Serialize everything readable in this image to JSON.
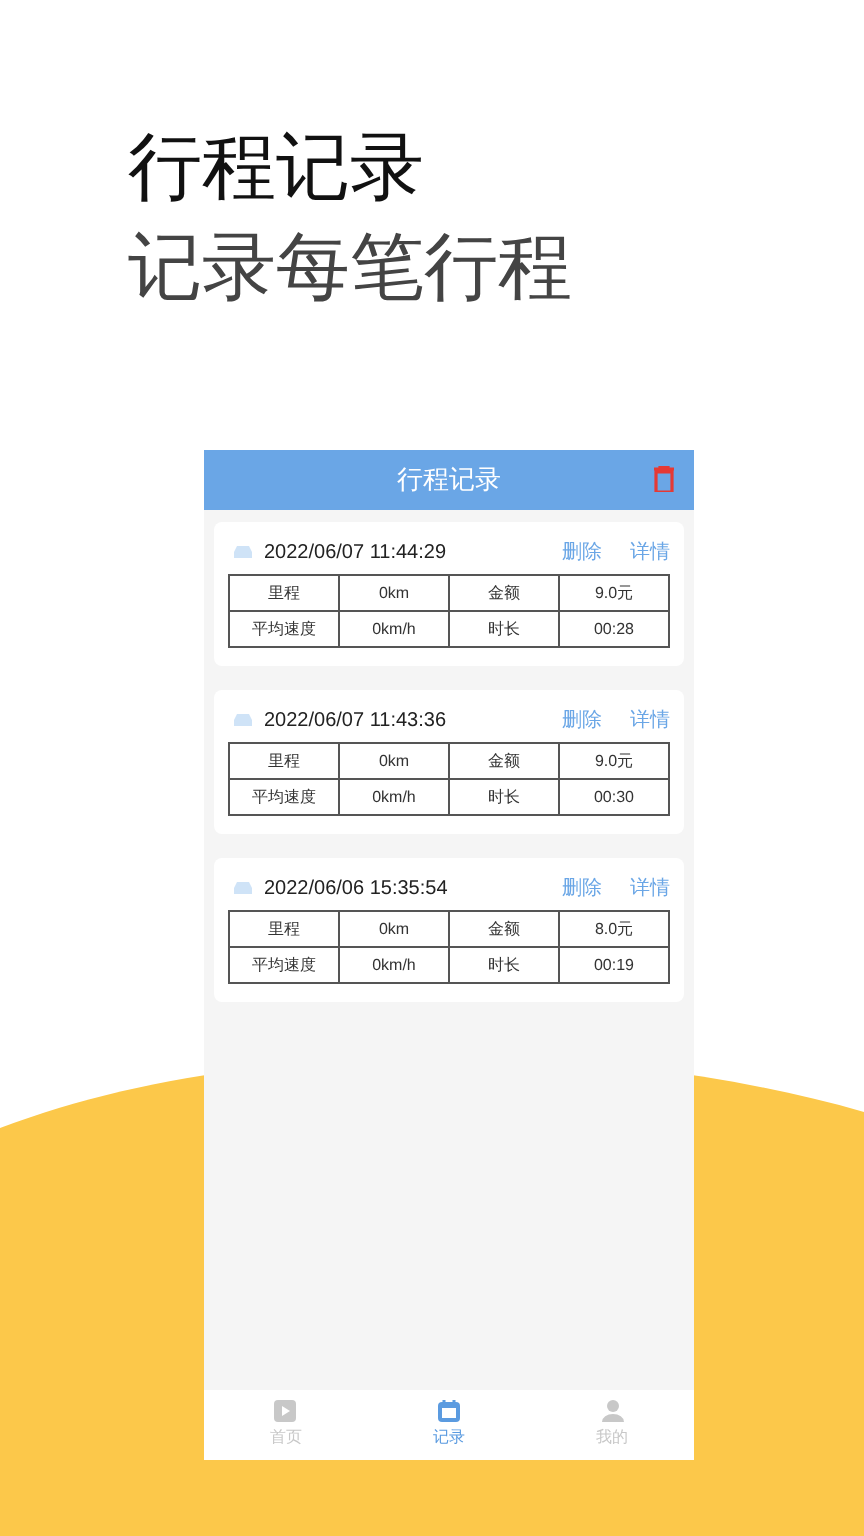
{
  "headline": [
    "行程记录",
    "记录每笔行程"
  ],
  "app": {
    "title": "行程记录",
    "trips": [
      {
        "time": "2022/06/07 11:44:29",
        "delete": "删除",
        "details": "详情",
        "cells": [
          [
            "里程",
            "0km",
            "金额",
            "9.0元"
          ],
          [
            "平均速度",
            "0km/h",
            "时长",
            "00:28"
          ]
        ]
      },
      {
        "time": "2022/06/07 11:43:36",
        "delete": "删除",
        "details": "详情",
        "cells": [
          [
            "里程",
            "0km",
            "金额",
            "9.0元"
          ],
          [
            "平均速度",
            "0km/h",
            "时长",
            "00:30"
          ]
        ]
      },
      {
        "time": "2022/06/06 15:35:54",
        "delete": "删除",
        "details": "详情",
        "cells": [
          [
            "里程",
            "0km",
            "金额",
            "8.0元"
          ],
          [
            "平均速度",
            "0km/h",
            "时长",
            "00:19"
          ]
        ]
      }
    ],
    "tabs": [
      {
        "kind": "home",
        "label": "首页",
        "selected": false
      },
      {
        "kind": "calendar",
        "label": "记录",
        "selected": true
      },
      {
        "kind": "person",
        "label": "我的",
        "selected": false
      }
    ]
  }
}
